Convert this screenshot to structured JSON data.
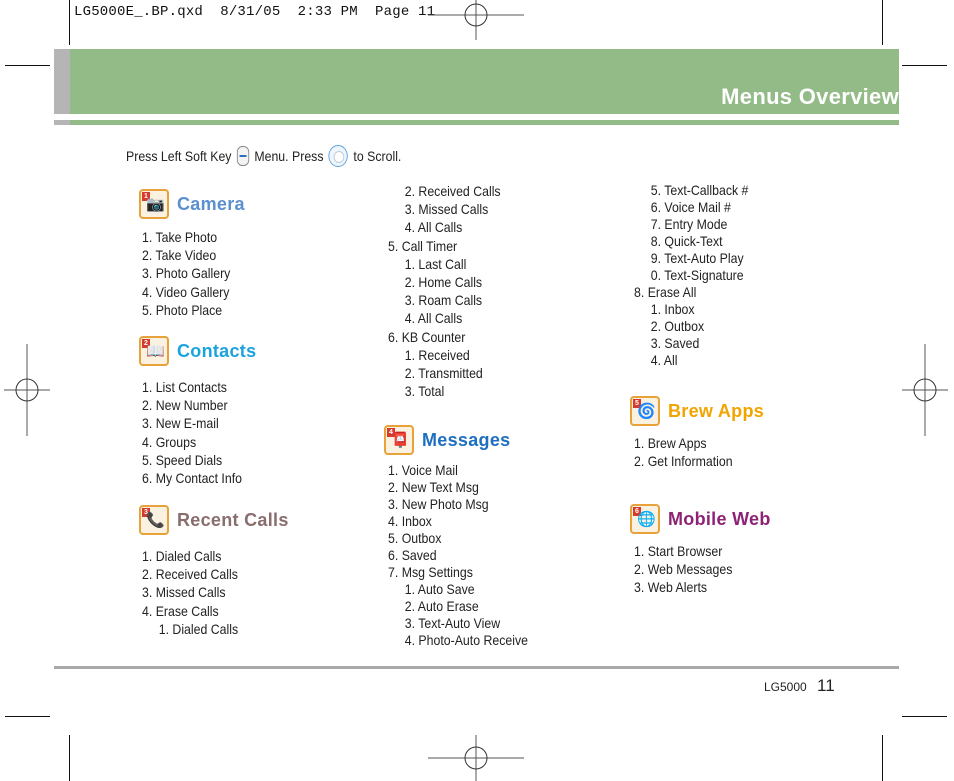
{
  "slug": "LG5000E_.BP.qxd  8/31/05  2:33 PM  Page 11",
  "header": {
    "title": "Menus Overview"
  },
  "instructions": {
    "part1": "Press Left Soft Key",
    "icon1": "left-soft-key-icon",
    "part2": "Menu. Press",
    "icon2": "navigation-key-icon",
    "part3": "to Scroll."
  },
  "colors": {
    "header_green": "#93bb87",
    "header_grey": "#b5b5b5",
    "camera": "#5b8fd0",
    "contacts": "#1aa3df",
    "recent_calls": "#8a6d6d",
    "messages": "#1f6fc0",
    "brew_apps": "#f2a400",
    "mobile_web": "#8c2375"
  },
  "sections": {
    "camera": {
      "number": "1",
      "title": "Camera",
      "icon": "camera-icon",
      "items": [
        "1. Take Photo",
        "2. Take Video",
        "3. Photo Gallery",
        "4. Video Gallery",
        "5. Photo Place"
      ]
    },
    "contacts": {
      "number": "2",
      "title": "Contacts",
      "icon": "address-book-icon",
      "items": [
        "1. List Contacts",
        "2. New Number",
        "3. New E-mail",
        "4. Groups",
        "5. Speed Dials",
        "6. My Contact Info"
      ]
    },
    "recent_calls": {
      "number": "3",
      "title": "Recent Calls",
      "icon": "phone-log-icon",
      "items": [
        "1. Dialed Calls",
        "2. Received Calls",
        "3. Missed Calls",
        "4. Erase Calls"
      ],
      "sub_items": [
        "1. Dialed Calls"
      ]
    },
    "recent_calls_cont": [
      {
        "text": "2. Received Calls",
        "sub": true
      },
      {
        "text": "3. Missed Calls",
        "sub": true
      },
      {
        "text": "4. All Calls",
        "sub": true
      },
      {
        "text": "5. Call Timer",
        "sub": false
      },
      {
        "text": "1. Last Call",
        "sub": true
      },
      {
        "text": "2. Home Calls",
        "sub": true
      },
      {
        "text": "3. Roam Calls",
        "sub": true
      },
      {
        "text": "4. All Calls",
        "sub": true
      },
      {
        "text": "6. KB Counter",
        "sub": false
      },
      {
        "text": "1. Received",
        "sub": true
      },
      {
        "text": "2. Transmitted",
        "sub": true
      },
      {
        "text": "3. Total",
        "sub": true
      }
    ],
    "messages": {
      "number": "4",
      "title": "Messages",
      "icon": "mailbox-icon",
      "items": [
        {
          "text": "1. Voice Mail",
          "sub": false
        },
        {
          "text": "2. New Text Msg",
          "sub": false
        },
        {
          "text": "3. New Photo Msg",
          "sub": false
        },
        {
          "text": "4. Inbox",
          "sub": false
        },
        {
          "text": "5. Outbox",
          "sub": false
        },
        {
          "text": "6. Saved",
          "sub": false
        },
        {
          "text": "7. Msg Settings",
          "sub": false
        },
        {
          "text": "1. Auto Save",
          "sub": true
        },
        {
          "text": "2. Auto Erase",
          "sub": true
        },
        {
          "text": "3. Text-Auto View",
          "sub": true
        },
        {
          "text": "4. Photo-Auto Receive",
          "sub": true
        }
      ]
    },
    "messages_cont": [
      {
        "text": "5. Text-Callback #",
        "sub": true
      },
      {
        "text": "6. Voice Mail #",
        "sub": true
      },
      {
        "text": "7. Entry Mode",
        "sub": true
      },
      {
        "text": "8. Quick-Text",
        "sub": true
      },
      {
        "text": "9. Text-Auto Play",
        "sub": true
      },
      {
        "text": "0. Text-Signature",
        "sub": true
      },
      {
        "text": "8. Erase All",
        "sub": false
      },
      {
        "text": "1. Inbox",
        "sub": true
      },
      {
        "text": "2. Outbox",
        "sub": true
      },
      {
        "text": "3. Saved",
        "sub": true
      },
      {
        "text": "4. All",
        "sub": true
      }
    ],
    "brew_apps": {
      "number": "5",
      "title": "Brew Apps",
      "icon": "brew-apps-icon",
      "items": [
        "1. Brew Apps",
        "2. Get Information"
      ]
    },
    "mobile_web": {
      "number": "6",
      "title": "Mobile Web",
      "icon": "globe-icon",
      "items": [
        "1. Start Browser",
        "2. Web Messages",
        "3. Web Alerts"
      ]
    }
  },
  "footer": {
    "model": "LG5000",
    "page": "11"
  }
}
